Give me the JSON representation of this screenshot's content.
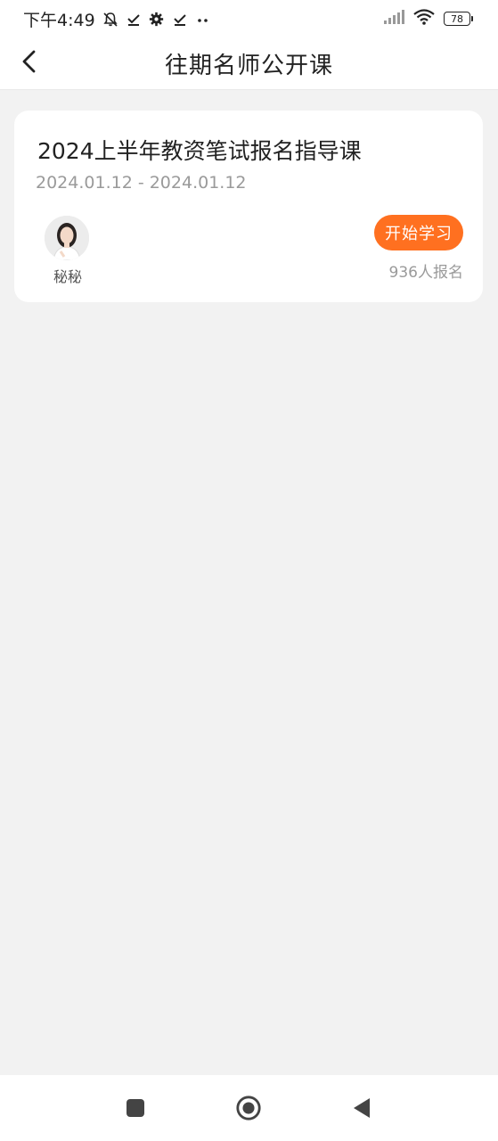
{
  "status_bar": {
    "time": "下午4:49",
    "battery_level": "78",
    "icons": [
      "bell-muted-icon",
      "check-download-icon",
      "gear-icon",
      "check-download-icon",
      "more-dots-icon",
      "signal-icon",
      "wifi-icon",
      "battery-icon"
    ]
  },
  "header": {
    "title": "往期名师公开课",
    "back_icon": "chevron-left-icon"
  },
  "courses": [
    {
      "title": "2024上半年教资笔试报名指导课",
      "date_range": "2024.01.12 - 2024.01.12",
      "teacher_name": "秘秘",
      "action_label": "开始学习",
      "enroll_count": "936人报名"
    }
  ],
  "colors": {
    "accent": "#ff7020",
    "background": "#f2f2f2",
    "card": "#ffffff",
    "muted_text": "#9a9a9a"
  },
  "nav_bar": {
    "icons": [
      "recent-apps-icon",
      "home-icon",
      "back-icon"
    ]
  }
}
